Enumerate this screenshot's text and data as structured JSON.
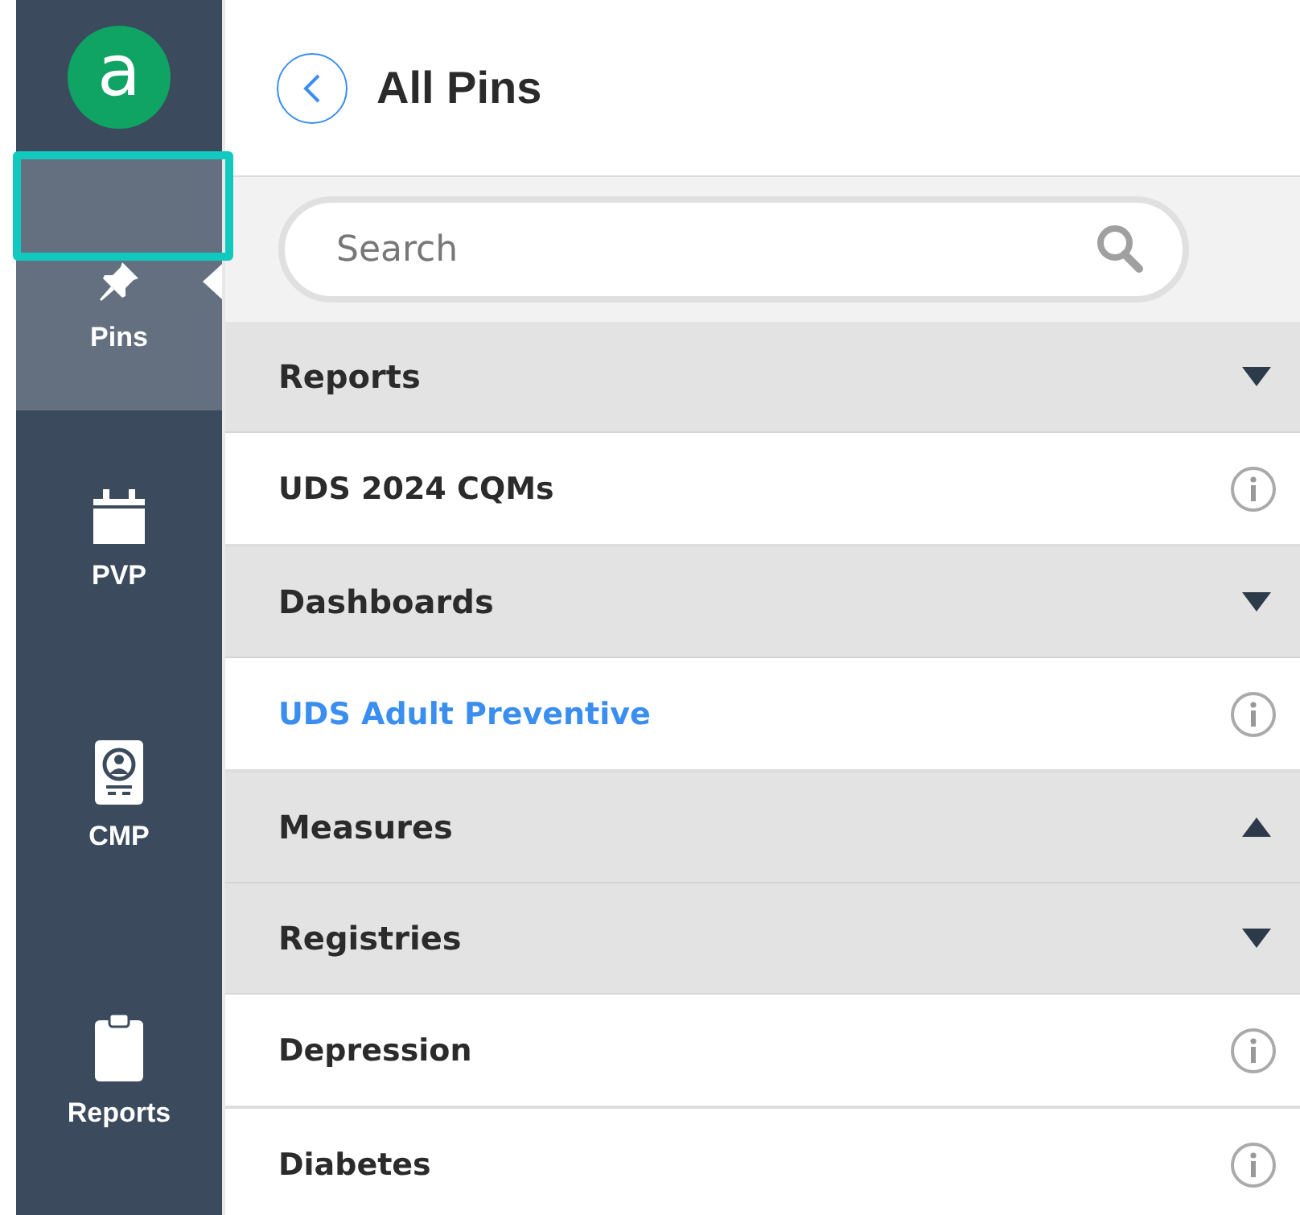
{
  "logo": {
    "letter": "a"
  },
  "nav": [
    {
      "label": "Pins",
      "kind": "pin",
      "selected": true
    },
    {
      "label": "PVP",
      "kind": "calendar",
      "selected": false
    },
    {
      "label": "CMP",
      "kind": "badge",
      "selected": false
    },
    {
      "label": "Reports",
      "kind": "clipboard",
      "selected": false
    }
  ],
  "title": "All Pins",
  "search": {
    "placeholder": "Search"
  },
  "sections": [
    {
      "title": "Reports",
      "expanded": false,
      "items": [
        {
          "label": "UDS 2024 CQMs",
          "selected": false
        }
      ]
    },
    {
      "title": "Dashboards",
      "expanded": false,
      "items": [
        {
          "label": "UDS Adult Preventive",
          "selected": true
        }
      ]
    },
    {
      "title": "Measures",
      "expanded": true
    },
    {
      "title": "Registries",
      "expanded": false,
      "items": [
        {
          "label": "Depression",
          "selected": false
        },
        {
          "label": "Diabetes",
          "selected": false
        }
      ]
    }
  ],
  "highlight": {
    "shown": true
  }
}
